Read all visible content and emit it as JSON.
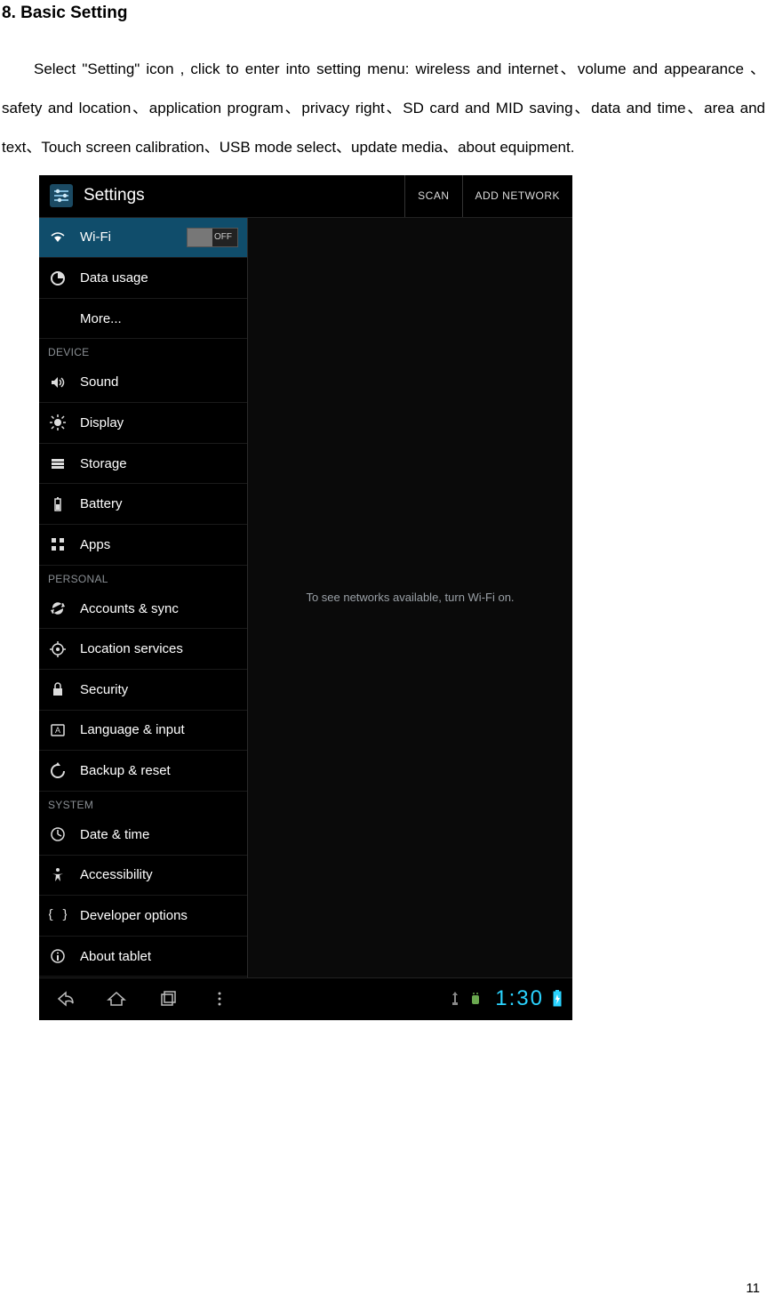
{
  "heading": "8. Basic Setting",
  "paragraph_parts": {
    "a": "Select \"Setting\" icon , click to enter into setting menu: wireless and internet、volume and appearance 、safety and location、application program、privacy right、SD card and MID saving、data and time、area and text、Touch screen calibration、USB mode select、update media、about equipment."
  },
  "screenshot": {
    "header": {
      "title": "Settings",
      "scan": "SCAN",
      "add": "ADD NETWORK"
    },
    "sidebar": {
      "wifi": {
        "label": "Wi-Fi",
        "toggle": "OFF"
      },
      "datausage": "Data usage",
      "more": "More...",
      "cat_device": "DEVICE",
      "sound": "Sound",
      "display": "Display",
      "storage": "Storage",
      "battery": "Battery",
      "apps": "Apps",
      "cat_personal": "PERSONAL",
      "accounts": "Accounts & sync",
      "location": "Location services",
      "security": "Security",
      "language": "Language & input",
      "backup": "Backup & reset",
      "cat_system": "SYSTEM",
      "datetime": "Date & time",
      "accessibility": "Accessibility",
      "developer": "Developer options",
      "about": "About tablet"
    },
    "content_msg": "To see networks available, turn Wi-Fi on.",
    "nav": {
      "clock": "1:30"
    }
  },
  "page_number": "11"
}
